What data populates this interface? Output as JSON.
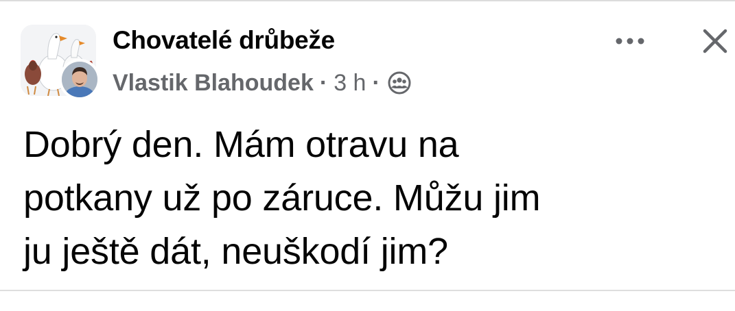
{
  "post": {
    "group_name": "Chovatelé drůbeže",
    "author": "Vlastik Blahoudek",
    "separator": "·",
    "time": "3 h",
    "audience_icon": "group-audience-icon",
    "text_lines": [
      "Dobrý den. Mám otravu na",
      "potkany už po záruce. Můžu jim",
      "ju ještě dát, neuškodí jim?"
    ]
  },
  "actions": {
    "more_icon": "more-horizontal-icon",
    "close_icon": "close-icon"
  },
  "colors": {
    "primary_text": "#050505",
    "secondary_text": "#65676b",
    "divider": "#dedede",
    "background": "#ffffff"
  }
}
